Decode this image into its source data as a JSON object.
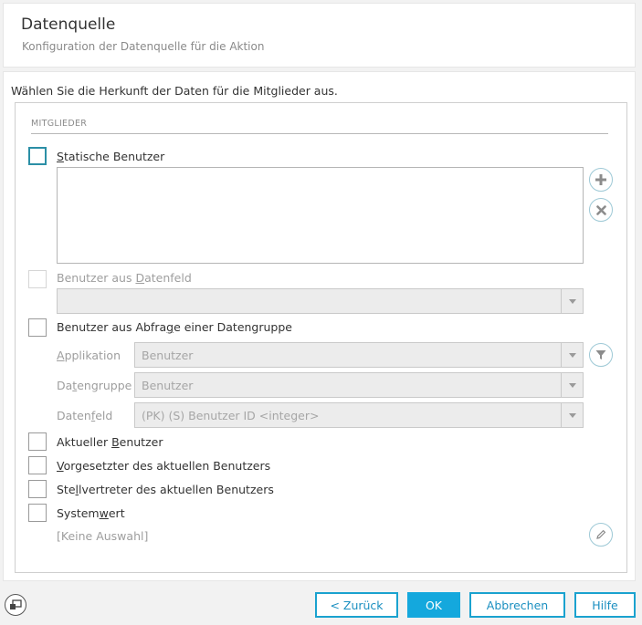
{
  "header": {
    "title": "Datenquelle",
    "subtitle": "Konfiguration der Datenquelle für die Aktion"
  },
  "instruction": "Wählen Sie die Herkunft der Daten für die Mitglieder aus.",
  "section": {
    "title": "MITGLIEDER"
  },
  "options": {
    "static_users": {
      "pre": "",
      "key": "S",
      "post": "tatische Benutzer"
    },
    "users_from_field": {
      "pre": "Benutzer aus ",
      "key": "D",
      "post": "atenfeld"
    },
    "users_from_query": {
      "pre": "Benutzer aus Abfra",
      "key": "g",
      "post": "e einer Datengruppe"
    },
    "current_user": {
      "pre": "Aktueller ",
      "key": "B",
      "post": "enutzer"
    },
    "supervisor": {
      "pre": "",
      "key": "V",
      "post": "orgesetzter des aktuellen Benutzers"
    },
    "deputy": {
      "pre": "Ste",
      "key": "l",
      "post": "lvertreter des aktuellen Benutzers"
    },
    "system_value": {
      "pre": "System",
      "key": "w",
      "post": "ert"
    }
  },
  "query_fields": {
    "application": {
      "pre": "",
      "key": "A",
      "post": "pplikation",
      "value": "Benutzer"
    },
    "datagroup": {
      "pre": "Da",
      "key": "t",
      "post": "engruppe",
      "value": "Benutzer"
    },
    "datafield": {
      "pre": "Daten",
      "key": "f",
      "post": "eld",
      "value": "(PK) (S) Benutzer ID <integer>"
    }
  },
  "datafield_select": {
    "value": ""
  },
  "system_value_text": "[Keine Auswahl]",
  "footer": {
    "back": "< Zurück",
    "ok": "OK",
    "cancel": "Abbrechen",
    "help": "Hilfe"
  },
  "colors": {
    "accent": "#14a8dd",
    "focus_border": "#2b8fa6"
  }
}
